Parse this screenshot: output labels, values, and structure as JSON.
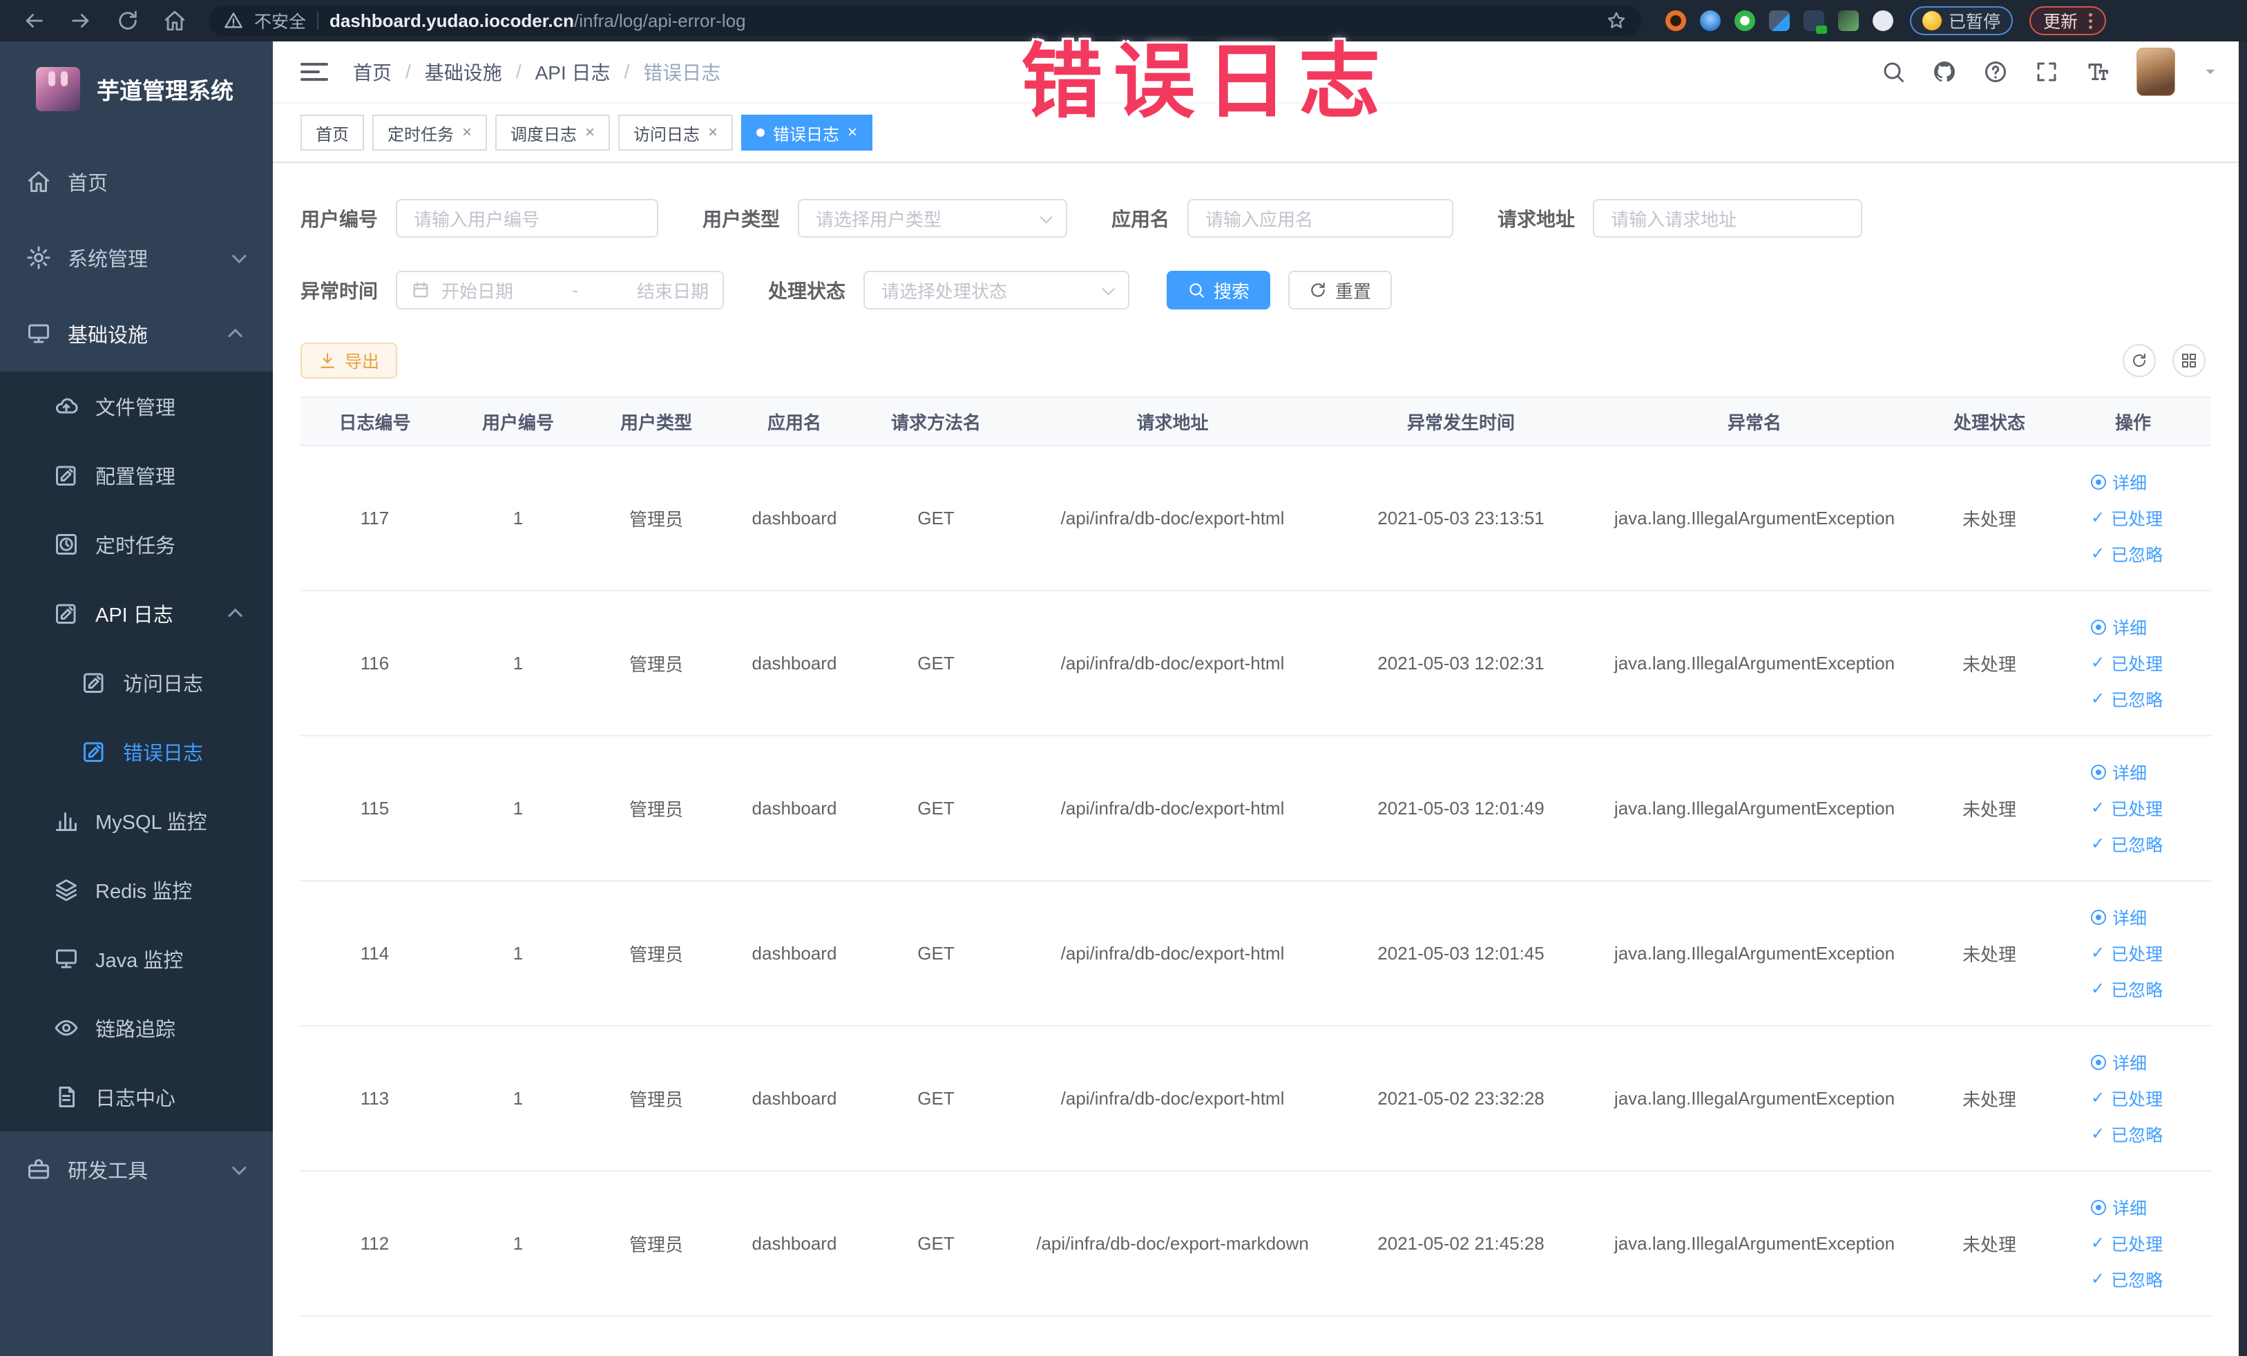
{
  "accent_color": "#409eff",
  "annotation": {
    "text": "错误日志",
    "color": "#f23a5e"
  },
  "browser": {
    "security_label": "不安全",
    "url_domain": "dashboard.yudao.iocoder.cn",
    "url_path": "/infra/log/api-error-log",
    "paused_label": "已暂停",
    "update_label": "更新"
  },
  "sidebar": {
    "title": "芋道管理系统",
    "items": [
      {
        "label": "首页"
      },
      {
        "label": "系统管理"
      },
      {
        "label": "基础设施"
      },
      {
        "label": "文件管理"
      },
      {
        "label": "配置管理"
      },
      {
        "label": "定时任务"
      },
      {
        "label": "API 日志"
      },
      {
        "label": "访问日志"
      },
      {
        "label": "错误日志"
      },
      {
        "label": "MySQL 监控"
      },
      {
        "label": "Redis 监控"
      },
      {
        "label": "Java 监控"
      },
      {
        "label": "链路追踪"
      },
      {
        "label": "日志中心"
      },
      {
        "label": "研发工具"
      }
    ]
  },
  "header": {
    "breadcrumb": [
      "首页",
      "基础设施",
      "API 日志",
      "错误日志"
    ],
    "separator": "/"
  },
  "tabs": [
    {
      "label": "首页"
    },
    {
      "label": "定时任务"
    },
    {
      "label": "调度日志"
    },
    {
      "label": "访问日志"
    },
    {
      "label": "错误日志"
    }
  ],
  "filters": {
    "user_id_label": "用户编号",
    "user_id_placeholder": "请输入用户编号",
    "user_type_label": "用户类型",
    "user_type_placeholder": "请选择用户类型",
    "app_name_label": "应用名",
    "app_name_placeholder": "请输入应用名",
    "request_url_label": "请求地址",
    "request_url_placeholder": "请输入请求地址",
    "exception_time_label": "异常时间",
    "date_start_placeholder": "开始日期",
    "date_separator": "-",
    "date_end_placeholder": "结束日期",
    "process_status_label": "处理状态",
    "process_status_placeholder": "请选择处理状态",
    "search_label": "搜索",
    "reset_label": "重置"
  },
  "toolbar": {
    "export_label": "导出"
  },
  "table": {
    "columns": [
      "日志编号",
      "用户编号",
      "用户类型",
      "应用名",
      "请求方法名",
      "请求地址",
      "异常发生时间",
      "异常名",
      "处理状态",
      "操作"
    ],
    "row_actions": [
      "详细",
      "已处理",
      "已忽略"
    ],
    "rows": [
      {
        "id": "117",
        "user_id": "1",
        "user_type": "管理员",
        "app_name": "dashboard",
        "method": "GET",
        "url": "/api/infra/db-doc/export-html",
        "time": "2021-05-03 23:13:51",
        "exception": "java.lang.IllegalArgumentException",
        "status": "未处理"
      },
      {
        "id": "116",
        "user_id": "1",
        "user_type": "管理员",
        "app_name": "dashboard",
        "method": "GET",
        "url": "/api/infra/db-doc/export-html",
        "time": "2021-05-03 12:02:31",
        "exception": "java.lang.IllegalArgumentException",
        "status": "未处理"
      },
      {
        "id": "115",
        "user_id": "1",
        "user_type": "管理员",
        "app_name": "dashboard",
        "method": "GET",
        "url": "/api/infra/db-doc/export-html",
        "time": "2021-05-03 12:01:49",
        "exception": "java.lang.IllegalArgumentException",
        "status": "未处理"
      },
      {
        "id": "114",
        "user_id": "1",
        "user_type": "管理员",
        "app_name": "dashboard",
        "method": "GET",
        "url": "/api/infra/db-doc/export-html",
        "time": "2021-05-03 12:01:45",
        "exception": "java.lang.IllegalArgumentException",
        "status": "未处理"
      },
      {
        "id": "113",
        "user_id": "1",
        "user_type": "管理员",
        "app_name": "dashboard",
        "method": "GET",
        "url": "/api/infra/db-doc/export-html",
        "time": "2021-05-02 23:32:28",
        "exception": "java.lang.IllegalArgumentException",
        "status": "未处理"
      },
      {
        "id": "112",
        "user_id": "1",
        "user_type": "管理员",
        "app_name": "dashboard",
        "method": "GET",
        "url": "/api/infra/db-doc/export-markdown",
        "time": "2021-05-02 21:45:28",
        "exception": "java.lang.IllegalArgumentException",
        "status": "未处理"
      }
    ]
  }
}
